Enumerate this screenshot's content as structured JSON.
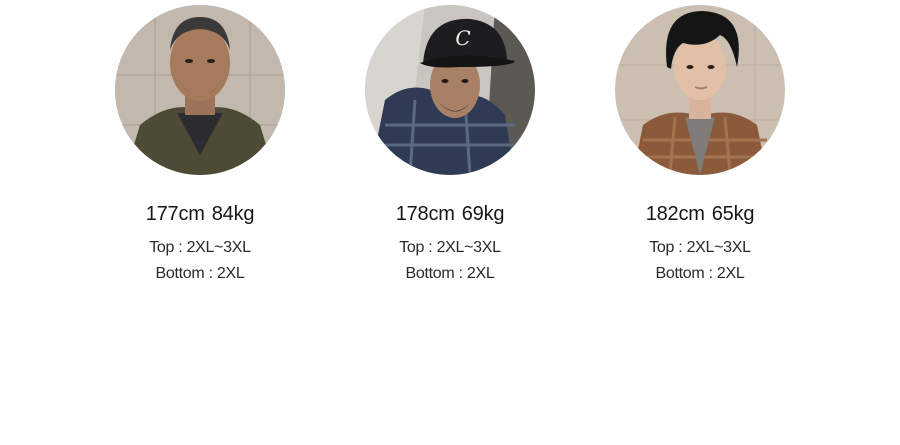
{
  "models": [
    {
      "height": "177cm",
      "weight": "84kg",
      "top_fit": "Top : 2XL~3XL",
      "bottom_fit": "Bottom : 2XL"
    },
    {
      "height": "178cm",
      "weight": "69kg",
      "top_fit": "Top : 2XL~3XL",
      "bottom_fit": "Bottom : 2XL"
    },
    {
      "height": "182cm",
      "weight": "65kg",
      "top_fit": "Top : 2XL~3XL",
      "bottom_fit": "Bottom : 2XL"
    }
  ]
}
